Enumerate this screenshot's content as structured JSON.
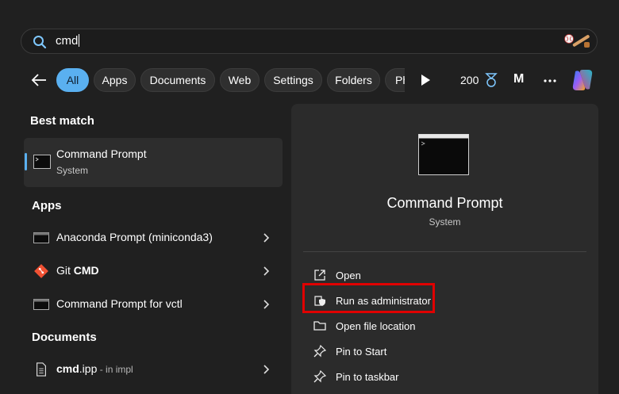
{
  "search": {
    "query": "cmd"
  },
  "filters": {
    "items": [
      "All",
      "Apps",
      "Documents",
      "Web",
      "Settings",
      "Folders"
    ],
    "cutoff_label": "Ph"
  },
  "header": {
    "points": "200",
    "avatar_initial": "M"
  },
  "best_match": {
    "heading": "Best match",
    "name": "Command Prompt",
    "sub": "System"
  },
  "apps": {
    "heading": "Apps",
    "items": [
      {
        "label": "Anaconda Prompt (miniconda3)"
      },
      {
        "prefix": "Git ",
        "bold": "CMD"
      },
      {
        "label": "Command Prompt for vctl"
      }
    ]
  },
  "documents": {
    "heading": "Documents",
    "items": [
      {
        "bold": "cmd",
        "rest": ".ipp",
        "sub": " - in impl"
      }
    ]
  },
  "detail": {
    "title": "Command Prompt",
    "sub": "System",
    "actions": [
      "Open",
      "Run as administrator",
      "Open file location",
      "Pin to Start",
      "Pin to taskbar"
    ]
  },
  "colors": {
    "accent": "#5ab0f0",
    "highlight": "#e00000"
  }
}
